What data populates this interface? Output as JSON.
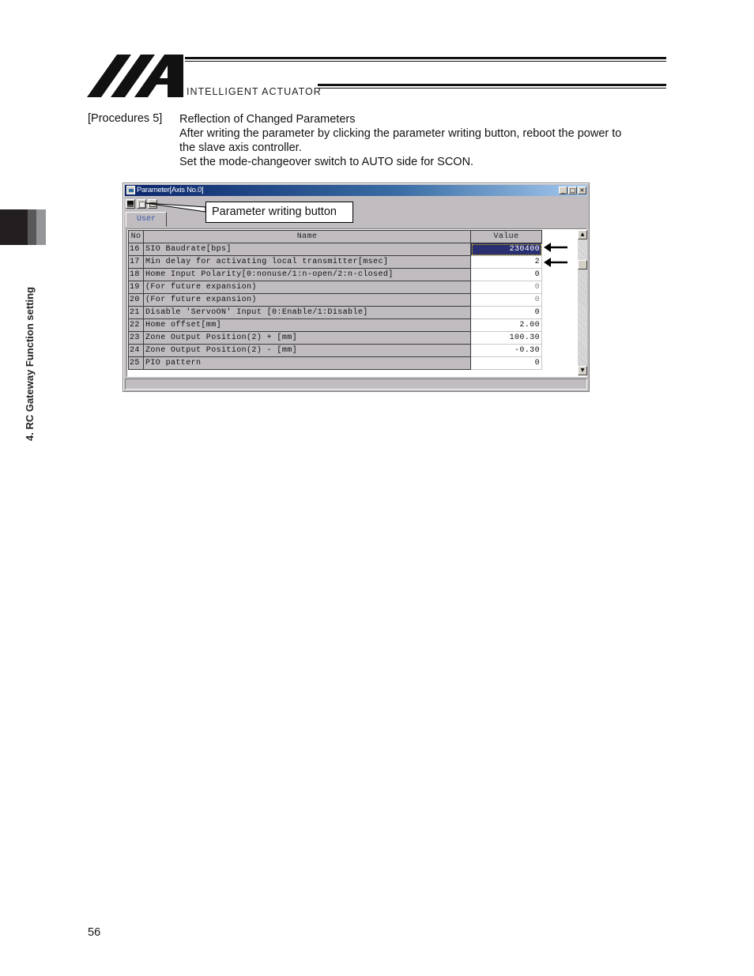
{
  "header": {
    "brand_text": "INTELLIGENT ACTUATOR",
    "logo": "iai-logo"
  },
  "side_tab": {
    "label": "4. RC Gateway Function setting"
  },
  "procedure": {
    "label": "[Procedures 5]",
    "title": "Reflection of Changed Parameters",
    "lines": [
      "After writing the parameter by clicking the parameter writing button, reboot the power to",
      "the slave axis controller.",
      "Set the mode-changeover switch to AUTO side for SCON."
    ]
  },
  "window": {
    "title": "Parameter[Axis No.0]",
    "controls": {
      "minimize": "_",
      "maximize": "□",
      "close": "×"
    },
    "toolbar": [
      {
        "name": "save",
        "icon": "floppy-disk-icon"
      },
      {
        "name": "write-parameter",
        "icon": "write-icon"
      },
      {
        "name": "print",
        "icon": "printer-icon"
      }
    ],
    "callout": "Parameter writing button",
    "tab": "User",
    "columns": {
      "no": "No",
      "name": "Name",
      "value": "Value"
    },
    "rows": [
      {
        "no": "16",
        "name": "SIO Baudrate[bps]",
        "value": "230400",
        "selected": true,
        "arrow": true
      },
      {
        "no": "17",
        "name": "Min delay for activating local transmitter[msec]",
        "value": "2",
        "arrow": true
      },
      {
        "no": "18",
        "name": "Home Input Polarity[0:nonuse/1:n-open/2:n-closed]",
        "value": "0"
      },
      {
        "no": "19",
        "name": "(For future expansion)",
        "value": "0",
        "dim": true
      },
      {
        "no": "20",
        "name": "(For future expansion)",
        "value": "0",
        "dim": true
      },
      {
        "no": "21",
        "name": "Disable 'ServoON' Input [0:Enable/1:Disable]",
        "value": "0"
      },
      {
        "no": "22",
        "name": "Home offset[mm]",
        "value": "2.00"
      },
      {
        "no": "23",
        "name": "Zone Output Position(2) + [mm]",
        "value": "100.30"
      },
      {
        "no": "24",
        "name": "Zone Output Position(2) - [mm]",
        "value": "-0.30"
      },
      {
        "no": "25",
        "name": "PIO pattern",
        "value": "0"
      }
    ],
    "scrollbar": {
      "up": "▲",
      "down": "▼"
    }
  },
  "footer": {
    "page_number": "56"
  }
}
